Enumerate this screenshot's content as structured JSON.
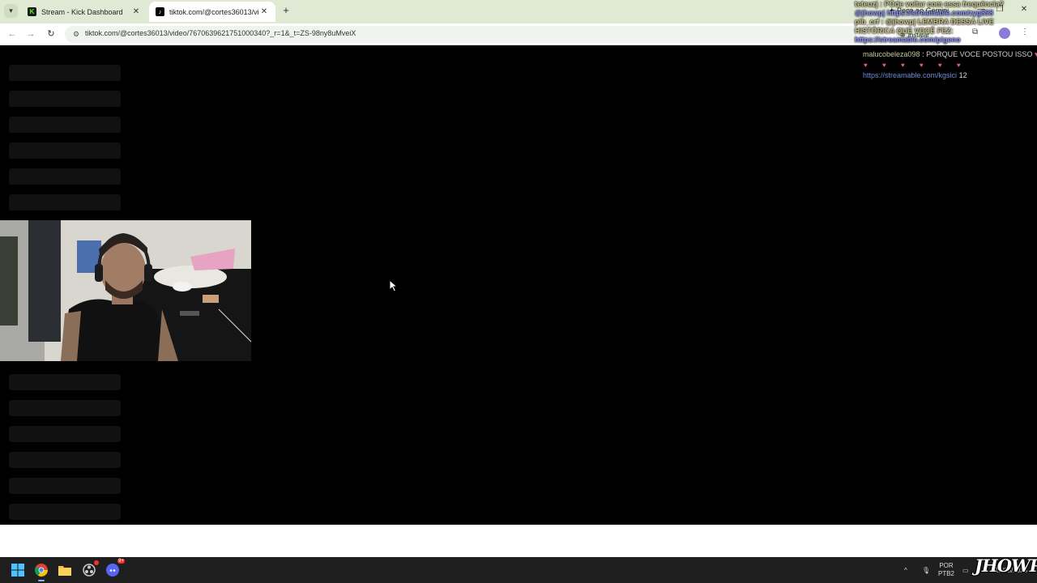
{
  "browser": {
    "tabs": [
      {
        "title": "Stream - Kick Dashboard",
        "favicon": "kick-logo-icon",
        "active": false
      },
      {
        "title": "tiktok.com/@cortes36013/vide...",
        "favicon": "tiktok-logo-icon",
        "active": true
      }
    ],
    "new_tab": "+",
    "url": "tiktok.com/@cortes36013/video/7670639621751000340?_r=1&_t=ZS-98ny8uMveiX",
    "gemini_label": "Peça ao Gemini",
    "install_label": "Instalar"
  },
  "chat": {
    "overlay_lines": [
      {
        "user": "teteuzj",
        "text": "POde voltar com essa frequência?"
      },
      {
        "user": "@jhowpj",
        "text": "https://streamable.com/zyg898",
        "mention": true
      },
      {
        "user": "plb_crf",
        "text": "@jhowpj LEMBRA DESSA LIVE HISTÓRICA QUE VOCÊ FEZ:",
        "link": "https://streamable.com/pigeno"
      }
    ],
    "message1": {
      "user": "malucobeleza098",
      "separator": " : ",
      "text": "PORQUE VOCE POSTOU ISSO"
    },
    "hearts": "♥ ♥ ♥ ♥ ♥ ♥",
    "message2": {
      "link": "https://streamable.com/kgsici",
      "text": "12"
    }
  },
  "taskbar": {
    "lang_line1": "POR",
    "lang_line2": "PTB2",
    "clock": "12/08/2025",
    "discord_badge": "9+"
  },
  "watermark": "JHOWPJ",
  "colors": {
    "tabstrip": "#dfe9d3",
    "page_bg": "#000000",
    "skeleton": "#111111",
    "taskbar": "#1f1f1f",
    "kick_green": "#53fc18"
  }
}
